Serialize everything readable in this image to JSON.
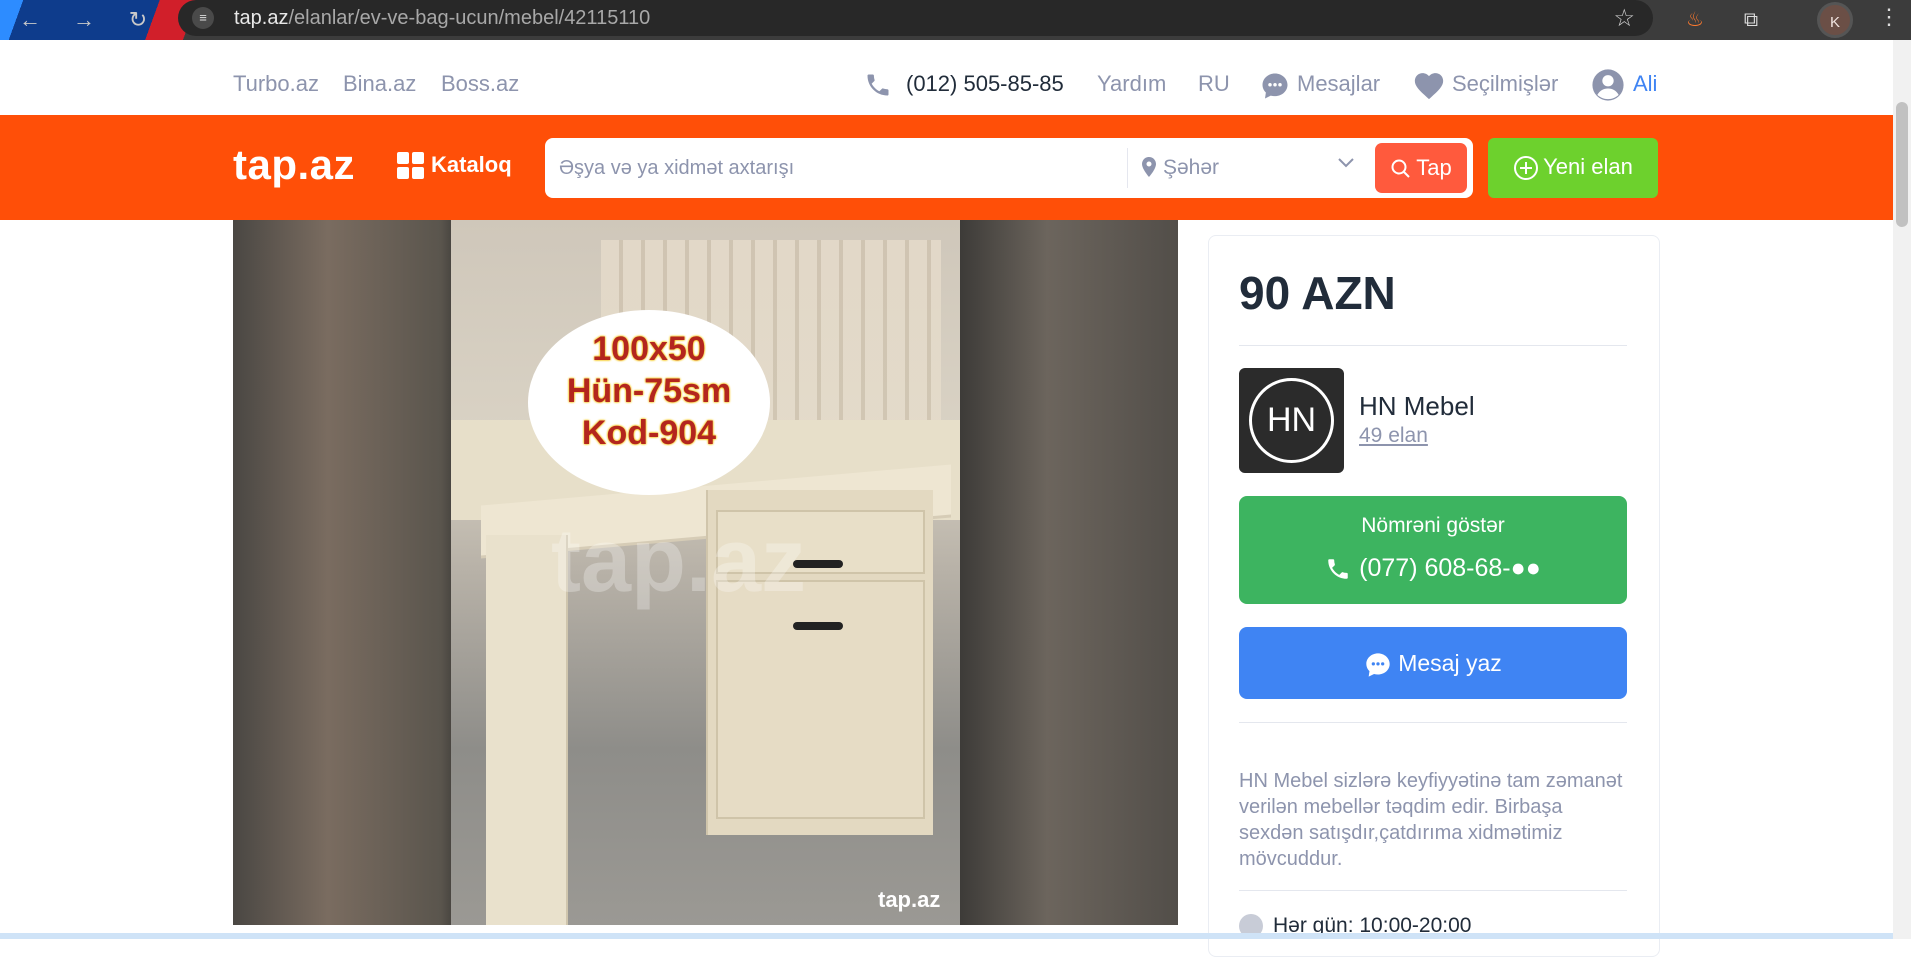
{
  "browser": {
    "url_host": "tap.az",
    "url_path": "/elanlar/ev-ve-bag-ucun/mebel/42115110",
    "profile_initial": "K"
  },
  "topbar": {
    "links": [
      "Turbo.az",
      "Bina.az",
      "Boss.az"
    ],
    "phone": "(012) 505-85-85",
    "help": "Yardım",
    "language": "RU",
    "messages": "Mesajlar",
    "favorites": "Seçilmişlər",
    "user": "Ali"
  },
  "header": {
    "logo": "tap.az",
    "catalog": "Kataloq",
    "search_placeholder": "Əşya və ya xidmət axtarışı",
    "city_placeholder": "Şəhər",
    "search_button": "Tap",
    "new_ad_button": "Yeni elan"
  },
  "listing": {
    "photo_badge_lines": [
      "100x50",
      "Hün-75sm",
      "Kod-904"
    ],
    "photo_watermark": "tap.az",
    "price": "90 AZN",
    "shop_name": "HN Mebel",
    "shop_logo_text": "HN",
    "shop_ads": "49 elan",
    "show_number_label": "Nömrəni göstər",
    "phone_masked": "(077) 608-68-●●",
    "message_button": "Mesaj yaz",
    "description": "HN Mebel sizlərə keyfiyyətinə tam zəmanət verilən mebellər təqdim edir. Birbaşa sexdən satışdır,çatdırıma xidmətimiz mövcuddur.",
    "hours": "Hər gün: 10:00-20:00"
  },
  "colors": {
    "brand_orange": "#ff4f08",
    "new_ad_green": "#6dd12d",
    "show_number_green": "#3db460",
    "message_blue": "#3f84f3"
  }
}
